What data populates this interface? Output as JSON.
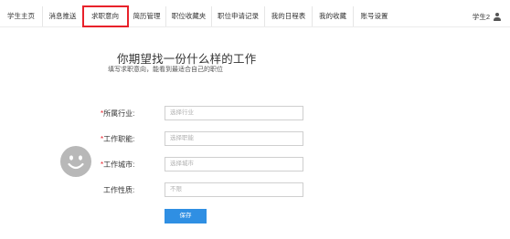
{
  "nav": {
    "tabs": [
      {
        "label": "学生主页",
        "active": false
      },
      {
        "label": "消息推送",
        "active": false
      },
      {
        "label": "求职意向",
        "active": true
      },
      {
        "label": "简历管理",
        "active": false
      },
      {
        "label": "职位收藏夹",
        "active": false
      },
      {
        "label": "职位申请记录",
        "active": false
      },
      {
        "label": "我的日程表",
        "active": false
      },
      {
        "label": "我的收藏",
        "active": false
      },
      {
        "label": "账号设置",
        "active": false
      }
    ],
    "user_name": "学生2",
    "user_icon": "user-icon"
  },
  "header": {
    "title": "你期望找一份什么样的工作",
    "subtitle": "填写求职意向，能看到最适合自己的职位"
  },
  "form": {
    "required_mark": "*",
    "fields": [
      {
        "label": "所属行业:",
        "required": true,
        "placeholder": "选择行业"
      },
      {
        "label": "工作职能:",
        "required": true,
        "placeholder": "选择职能"
      },
      {
        "label": "工作城市:",
        "required": true,
        "placeholder": "选择城市"
      },
      {
        "label": "工作性质:",
        "required": false,
        "placeholder": "不限"
      }
    ],
    "save_label": "保存"
  },
  "avatar_icon": "smiley-face-icon",
  "colors": {
    "accent": "#2f8fe3",
    "required": "#e8212a",
    "highlight": "#e8212a"
  }
}
